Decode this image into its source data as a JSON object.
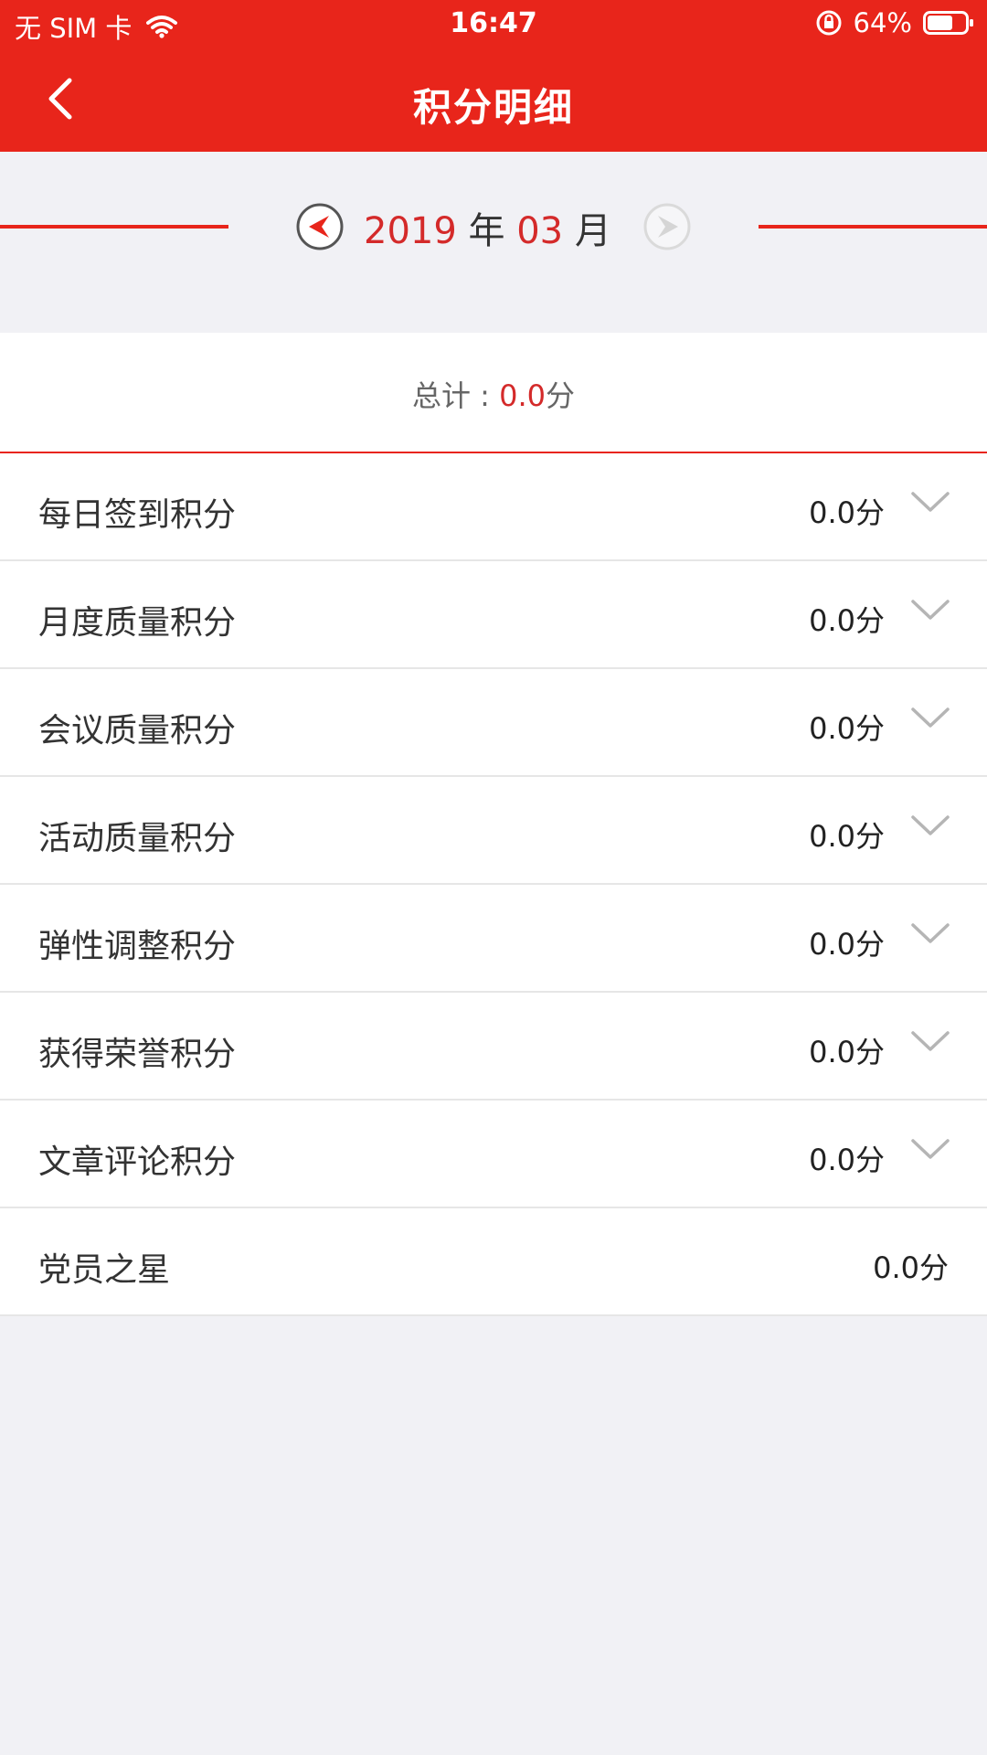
{
  "status_bar": {
    "carrier": "无 SIM 卡",
    "time": "16:47",
    "battery": "64%"
  },
  "nav": {
    "title": "积分明细"
  },
  "month_selector": {
    "year": "2019",
    "year_unit": "年",
    "month": "03",
    "month_unit": "月"
  },
  "summary": {
    "total_label": "总计 : ",
    "total_value": "0.0",
    "total_unit": "分"
  },
  "items": [
    {
      "label": "每日签到积分",
      "value": "0.0分"
    },
    {
      "label": "月度质量积分",
      "value": "0.0分"
    },
    {
      "label": "会议质量积分",
      "value": "0.0分"
    },
    {
      "label": "活动质量积分",
      "value": "0.0分"
    },
    {
      "label": "弹性调整积分",
      "value": "0.0分"
    },
    {
      "label": "获得荣誉积分",
      "value": "0.0分"
    },
    {
      "label": "文章评论积分",
      "value": "0.0分"
    },
    {
      "label": "党员之星",
      "value": "0.0分"
    }
  ],
  "colors": {
    "brand_red": "#e8251b",
    "accent_number": "#d42a2a",
    "background": "#f1f1f5"
  },
  "icons": {
    "back": "chevron-left-icon",
    "prev_month": "circle-arrow-left-icon",
    "next_month": "circle-arrow-right-icon",
    "expand": "chevron-down-icon",
    "wifi": "wifi-icon",
    "rotation_lock": "rotation-lock-icon",
    "battery": "battery-icon"
  }
}
